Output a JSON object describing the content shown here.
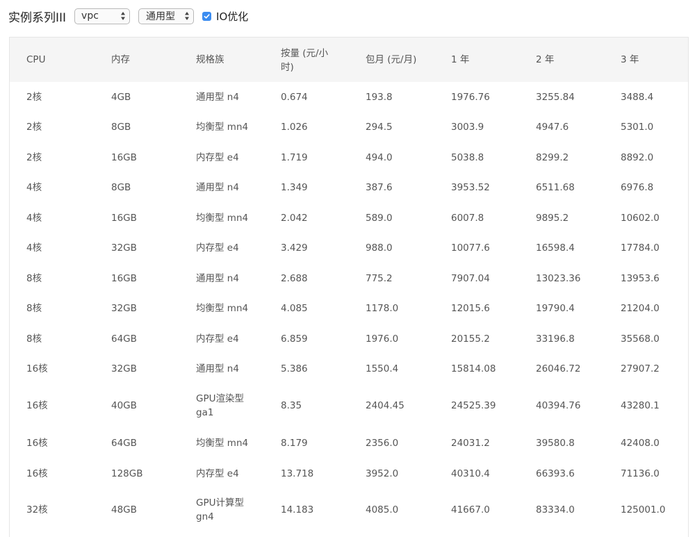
{
  "toolbar": {
    "series_label": "实例系列III",
    "network_select": "vpc",
    "type_select": "通用型",
    "io_checked": true,
    "io_label": "IO优化",
    "checkbox_color": "#3b8cf0"
  },
  "table": {
    "headers": [
      "CPU",
      "内存",
      "规格族",
      "按量 (元/小时)",
      "包月 (元/月)",
      "1 年",
      "2 年",
      "3 年"
    ],
    "rows": [
      [
        "2核",
        "4GB",
        "通用型 n4",
        "0.674",
        "193.8",
        "1976.76",
        "3255.84",
        "3488.4"
      ],
      [
        "2核",
        "8GB",
        "均衡型 mn4",
        "1.026",
        "294.5",
        "3003.9",
        "4947.6",
        "5301.0"
      ],
      [
        "2核",
        "16GB",
        "内存型 e4",
        "1.719",
        "494.0",
        "5038.8",
        "8299.2",
        "8892.0"
      ],
      [
        "4核",
        "8GB",
        "通用型 n4",
        "1.349",
        "387.6",
        "3953.52",
        "6511.68",
        "6976.8"
      ],
      [
        "4核",
        "16GB",
        "均衡型 mn4",
        "2.042",
        "589.0",
        "6007.8",
        "9895.2",
        "10602.0"
      ],
      [
        "4核",
        "32GB",
        "内存型 e4",
        "3.429",
        "988.0",
        "10077.6",
        "16598.4",
        "17784.0"
      ],
      [
        "8核",
        "16GB",
        "通用型 n4",
        "2.688",
        "775.2",
        "7907.04",
        "13023.36",
        "13953.6"
      ],
      [
        "8核",
        "32GB",
        "均衡型 mn4",
        "4.085",
        "1178.0",
        "12015.6",
        "19790.4",
        "21204.0"
      ],
      [
        "8核",
        "64GB",
        "内存型 e4",
        "6.859",
        "1976.0",
        "20155.2",
        "33196.8",
        "35568.0"
      ],
      [
        "16核",
        "32GB",
        "通用型 n4",
        "5.386",
        "1550.4",
        "15814.08",
        "26046.72",
        "27907.2"
      ],
      [
        "16核",
        "40GB",
        "GPU渲染型 ga1",
        "8.35",
        "2404.45",
        "24525.39",
        "40394.76",
        "43280.1"
      ],
      [
        "16核",
        "64GB",
        "均衡型 mn4",
        "8.179",
        "2356.0",
        "24031.2",
        "39580.8",
        "42408.0"
      ],
      [
        "16核",
        "128GB",
        "内存型 e4",
        "13.718",
        "3952.0",
        "40310.4",
        "66393.6",
        "71136.0"
      ],
      [
        "32核",
        "48GB",
        "GPU计算型 gn4",
        "14.183",
        "4085.0",
        "41667.0",
        "83334.0",
        "125001.0"
      ]
    ]
  }
}
